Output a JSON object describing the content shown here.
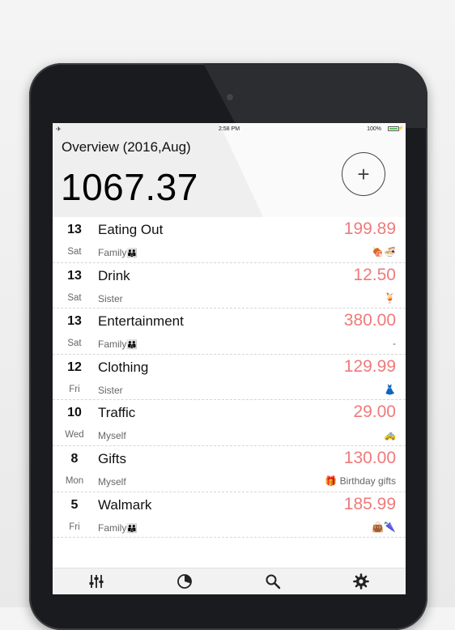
{
  "status_bar": {
    "time": "2:58 PM",
    "battery": "100%"
  },
  "header": {
    "title": "Overview (2016,Aug)",
    "total": "1067.37",
    "add_label": "+"
  },
  "entries": [
    {
      "day": "13",
      "weekday": "Sat",
      "category": "Eating Out",
      "amount": "199.89",
      "person": "Family",
      "person_emoji": "👪",
      "note": "🍖🍜"
    },
    {
      "day": "13",
      "weekday": "Sat",
      "category": "Drink",
      "amount": "12.50",
      "person": "Sister",
      "person_emoji": "",
      "note": "🍹"
    },
    {
      "day": "13",
      "weekday": "Sat",
      "category": "Entertainment",
      "amount": "380.00",
      "person": "Family",
      "person_emoji": "👪",
      "note": "-"
    },
    {
      "day": "12",
      "weekday": "Fri",
      "category": "Clothing",
      "amount": "129.99",
      "person": "Sister",
      "person_emoji": "",
      "note": "👗"
    },
    {
      "day": "10",
      "weekday": "Wed",
      "category": "Traffic",
      "amount": "29.00",
      "person": "Myself",
      "person_emoji": "",
      "note": "🚕"
    },
    {
      "day": "8",
      "weekday": "Mon",
      "category": "Gifts",
      "amount": "130.00",
      "person": "Myself",
      "person_emoji": "",
      "note": "🎁 Birthday gifts"
    },
    {
      "day": "5",
      "weekday": "Fri",
      "category": "Walmark",
      "amount": "185.99",
      "person": "Family",
      "person_emoji": "👪",
      "note": "👜🌂"
    }
  ],
  "tabbar": {
    "items": [
      "sliders-icon",
      "pie-chart-icon",
      "search-icon",
      "gear-icon"
    ]
  },
  "colors": {
    "amount": "#ef7a7a",
    "header_bg": "#efefef",
    "battery": "#5cc25c"
  }
}
